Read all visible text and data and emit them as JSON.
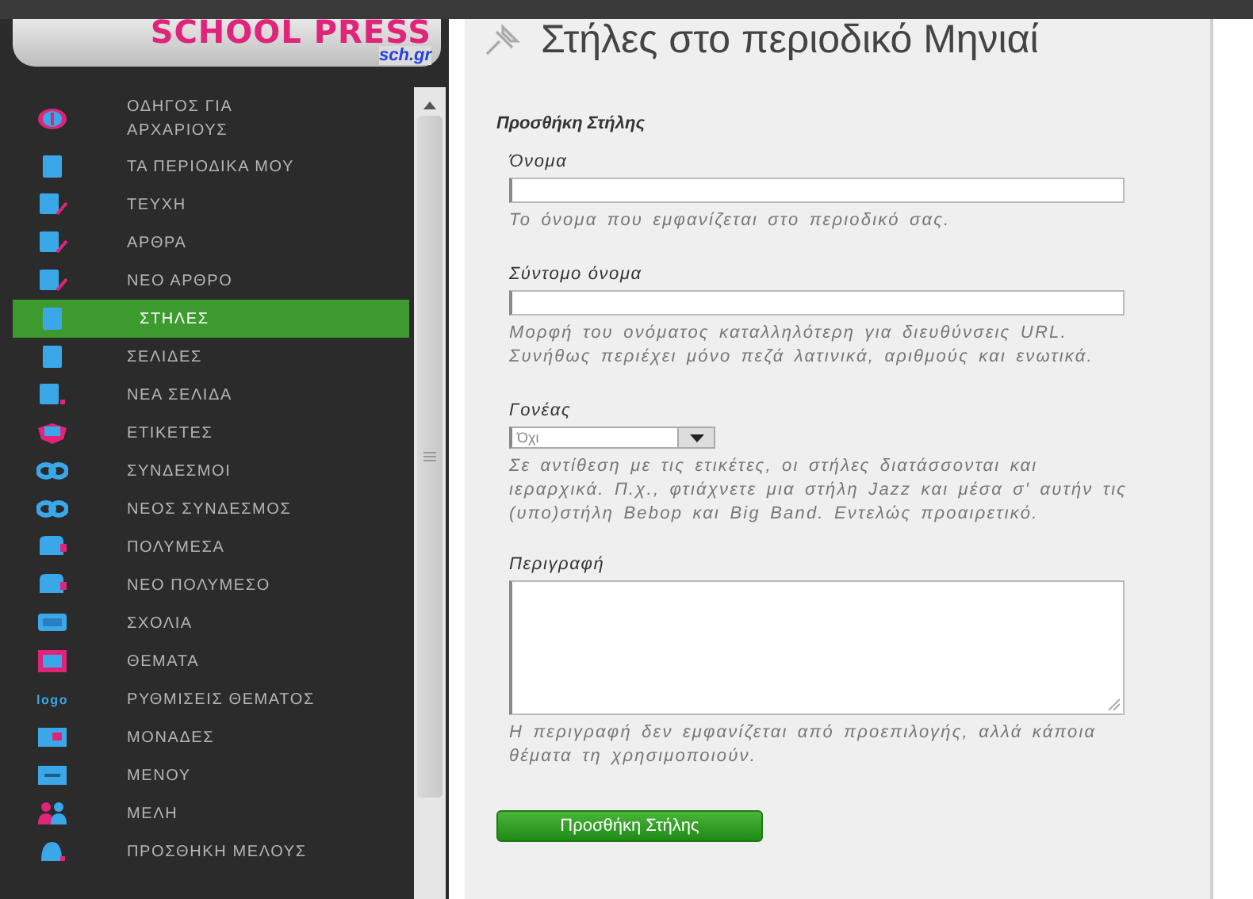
{
  "logo": {
    "title": "SCHOOL PRESS",
    "subtitle": "sch.gr"
  },
  "sidebar": {
    "items": [
      {
        "label": "ΟΔΗΓΟΣ ΓΙΑ ΑΡΧΑΡΙΟΥΣ",
        "selected": false
      },
      {
        "label": "ΤΑ ΠΕΡΙΟΔΙΚΑ ΜΟΥ",
        "selected": false
      },
      {
        "label": "ΤΕΥΧΗ",
        "selected": false
      },
      {
        "label": "ΑΡΘΡΑ",
        "selected": false
      },
      {
        "label": "ΝΕΟ ΑΡΘΡΟ",
        "selected": false
      },
      {
        "label": "ΣΤΗΛΕΣ",
        "selected": true
      },
      {
        "label": "ΣΕΛΙΔΕΣ",
        "selected": false
      },
      {
        "label": "ΝΕΑ ΣΕΛΙΔΑ",
        "selected": false
      },
      {
        "label": "ΕΤΙΚΕΤΕΣ",
        "selected": false
      },
      {
        "label": "ΣΥΝΔΕΣΜΟΙ",
        "selected": false
      },
      {
        "label": "ΝΕΟΣ ΣΥΝΔΕΣΜΟΣ",
        "selected": false
      },
      {
        "label": "ΠΟΛΥΜΕΣΑ",
        "selected": false
      },
      {
        "label": "ΝΕΟ ΠΟΛΥΜΕΣΟ",
        "selected": false
      },
      {
        "label": "ΣΧΟΛΙΑ",
        "selected": false
      },
      {
        "label": "ΘΕΜΑΤΑ",
        "selected": false
      },
      {
        "label": "ΡΥΘΜΙΣΕΙΣ ΘΕΜΑΤΟΣ",
        "selected": false,
        "icon_text": "logo"
      },
      {
        "label": "ΜΟΝΑΔΕΣ",
        "selected": false
      },
      {
        "label": "ΜΕΝΟΥ",
        "selected": false
      },
      {
        "label": "ΜΕΛΗ",
        "selected": false
      },
      {
        "label": "ΠΡΟΣΘΗΚΗ ΜΕΛΟΥΣ",
        "selected": false
      }
    ]
  },
  "page": {
    "title": "Στήλες στο περιοδικό Μηνιαί"
  },
  "form": {
    "heading": "Προσθήκη Στήλης",
    "fields": [
      {
        "kind": "text",
        "label": "Όνομα",
        "help": "Το όνομα που εμφανίζεται στο περιοδικό σας."
      },
      {
        "kind": "text",
        "label": "Σύντομο όνομα",
        "help": "Μορφή του ονόματος καταλληλότερη για διευθύνσεις URL. Συνήθως περιέχει μόνο πεζά λατινικά, αριθμούς και ενωτικά."
      },
      {
        "kind": "select",
        "label": "Γονέας",
        "value": "Όχι",
        "help": "Σε αντίθεση με τις ετικέτες, οι στήλες διατάσσονται και ιεραρχικά. Π.χ., φτιάχνετε μια στήλη Jazz και μέσα σ' αυτήν τις (υπο)στήλη Bebop και Big Band. Εντελώς προαιρετικό."
      },
      {
        "kind": "textarea",
        "label": "Περιγραφή",
        "help": "Η περιγραφή δεν εμφανίζεται από προεπιλογής, αλλά κάποια θέματα τη χρησιμοποιούν."
      }
    ],
    "button": "Προσθήκη Στήλης"
  }
}
